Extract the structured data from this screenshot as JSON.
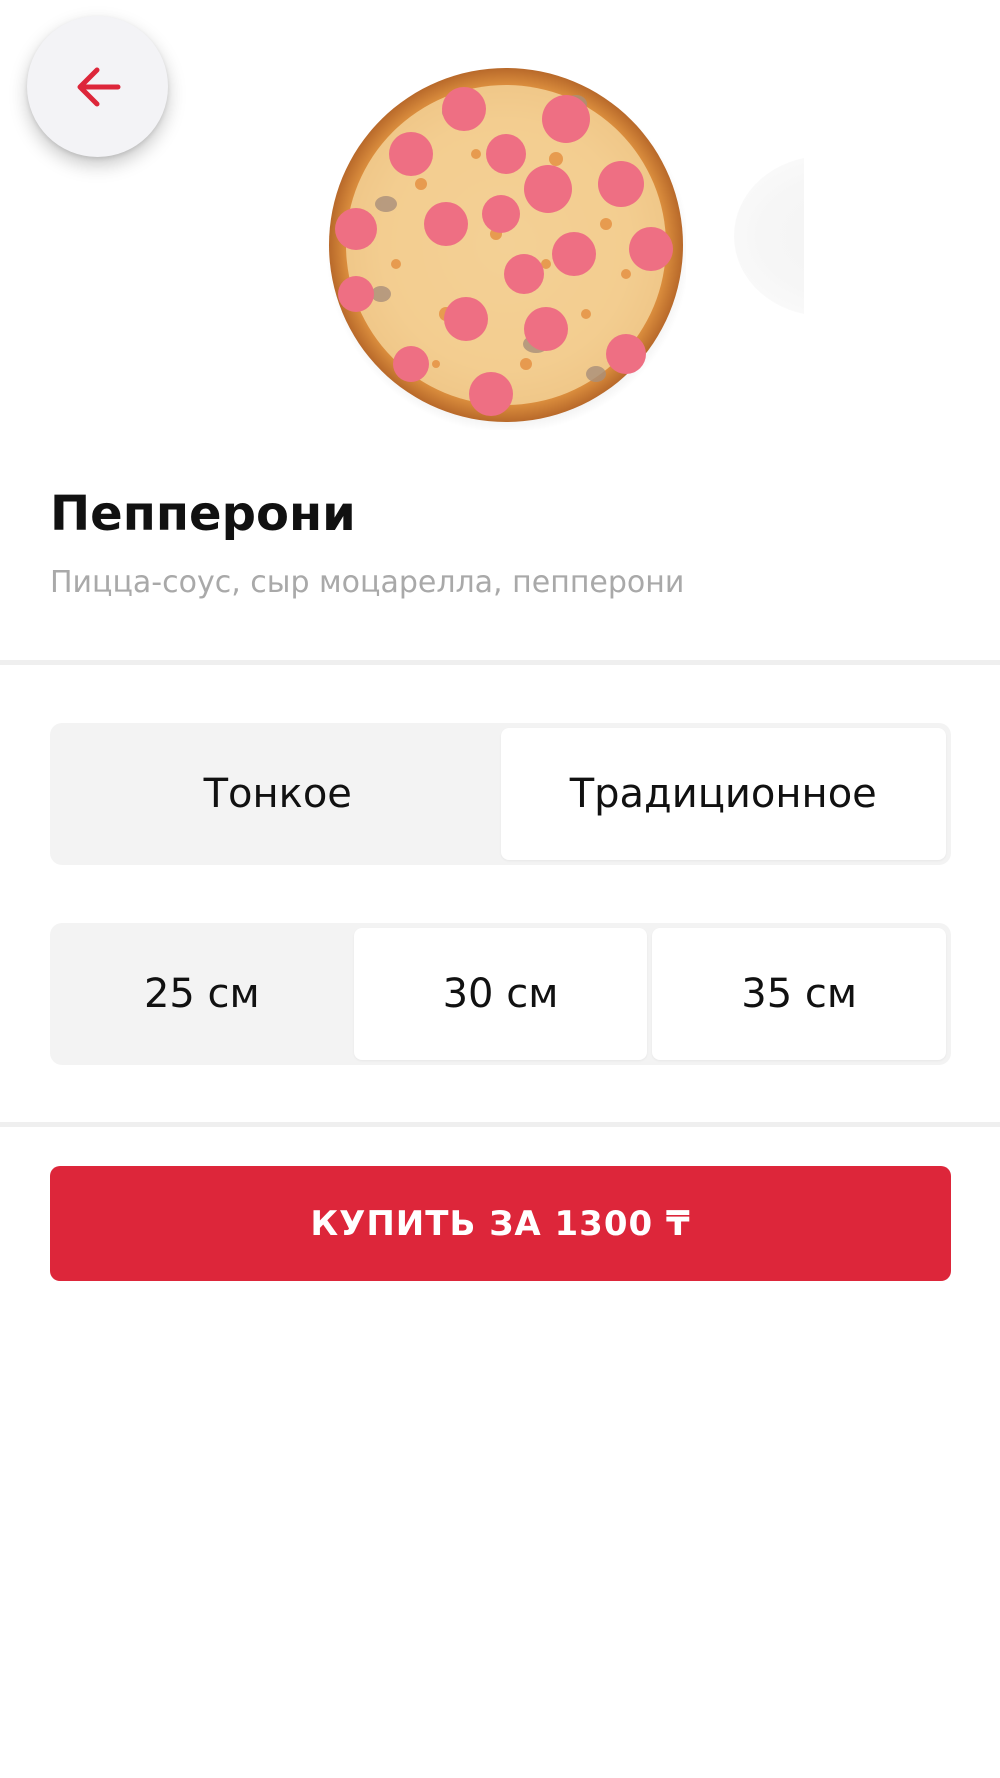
{
  "header": {
    "back_icon": "arrow-left-icon",
    "accent_color": "#dd263a"
  },
  "product": {
    "image": "pizza-pepperoni-image",
    "title": "Пепперони",
    "description": "Пицца-соус, сыр моцарелла, пепперони"
  },
  "crust_options": {
    "items": [
      {
        "label": "Тонкое",
        "selected": false
      },
      {
        "label": "Традиционное",
        "selected": true
      }
    ]
  },
  "size_options": {
    "items": [
      {
        "label": "25 см",
        "selected": false
      },
      {
        "label": "30 см",
        "selected": true
      },
      {
        "label": "35 см",
        "selected": true
      }
    ]
  },
  "buy_button": {
    "label": "КУПИТЬ ЗА 1300 ₸",
    "color": "#dd263a"
  }
}
